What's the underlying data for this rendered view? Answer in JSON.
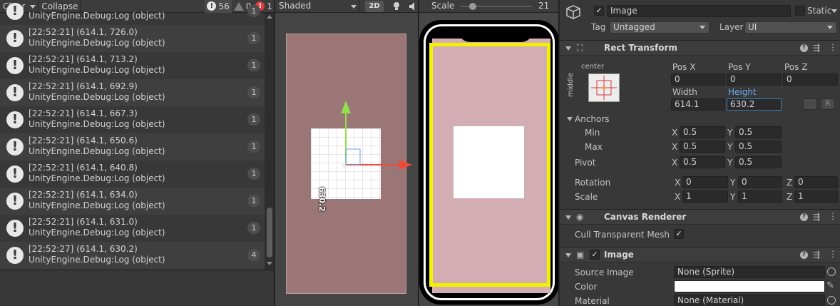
{
  "console": {
    "toolbar": {
      "clear_label": "Clear",
      "collapse_label": "Collapse",
      "info_count": "56",
      "warn_count": "0",
      "error_count": "1"
    },
    "logs": [
      {
        "line1": "",
        "line2": "UnityEngine.Debug:Log (object)",
        "count": "1"
      },
      {
        "line1": "[22:52:21] (614.1, 726.0)",
        "line2": "UnityEngine.Debug:Log (object)",
        "count": "1"
      },
      {
        "line1": "[22:52:21] (614.1, 713.2)",
        "line2": "UnityEngine.Debug:Log (object)",
        "count": "1"
      },
      {
        "line1": "[22:52:21] (614.1, 692.9)",
        "line2": "UnityEngine.Debug:Log (object)",
        "count": "1"
      },
      {
        "line1": "[22:52:21] (614.1, 667.3)",
        "line2": "UnityEngine.Debug:Log (object)",
        "count": "1"
      },
      {
        "line1": "[22:52:21] (614.1, 650.6)",
        "line2": "UnityEngine.Debug:Log (object)",
        "count": "1"
      },
      {
        "line1": "[22:52:21] (614.1, 640.8)",
        "line2": "UnityEngine.Debug:Log (object)",
        "count": "1"
      },
      {
        "line1": "[22:52:21] (614.1, 634.0)",
        "line2": "UnityEngine.Debug:Log (object)",
        "count": "1"
      },
      {
        "line1": "[22:52:21] (614.1, 631.0)",
        "line2": "UnityEngine.Debug:Log (object)",
        "count": "1"
      },
      {
        "line1": "[22:52:27] (614.1, 630.2)",
        "line2": "UnityEngine.Debug:Log (object)",
        "count": "4"
      }
    ]
  },
  "scene": {
    "shading_mode": "Shaded",
    "mode_2d": "2D",
    "gizmo_label": "630.2"
  },
  "game": {
    "scale_label": "Scale",
    "scale_value": "21"
  },
  "inspector": {
    "object_name": "Image",
    "static_label": "Static",
    "tag_label": "Tag",
    "tag_value": "Untagged",
    "layer_label": "Layer",
    "layer_value": "UI",
    "rect_transform": {
      "title": "Rect Transform",
      "anchor_h": "center",
      "anchor_v": "middle",
      "pos_x_label": "Pos X",
      "pos_x": "0",
      "pos_y_label": "Pos Y",
      "pos_y": "0",
      "pos_z_label": "Pos Z",
      "pos_z": "0",
      "width_label": "Width",
      "width": "614.1",
      "height_label": "Height",
      "height": "630.2",
      "blueprint_btn": "",
      "raw_btn": "R",
      "anchors_label": "Anchors",
      "min_label": "Min",
      "min_x": "0.5",
      "min_y": "0.5",
      "max_label": "Max",
      "max_x": "0.5",
      "max_y": "0.5",
      "pivot_label": "Pivot",
      "pivot_x": "0.5",
      "pivot_y": "0.5",
      "rotation_label": "Rotation",
      "rot_x": "0",
      "rot_y": "0",
      "rot_z": "0",
      "scale_label": "Scale",
      "scale_x": "1",
      "scale_y": "1",
      "scale_z": "1",
      "x": "X",
      "y": "Y",
      "z": "Z"
    },
    "canvas_renderer": {
      "title": "Canvas Renderer",
      "cull_label": "Cull Transparent Mesh"
    },
    "image": {
      "title": "Image",
      "source_label": "Source Image",
      "source_value": "None (Sprite)",
      "color_label": "Color",
      "color_value": "#ffffff",
      "material_label": "Material",
      "material_value": "None (Material)"
    }
  },
  "colors": {
    "game_bg": "#d2aeb4",
    "scene_canvas": "#9a7677",
    "safe_area": "#f2f200",
    "gizmo_y": "#8fe04b",
    "gizmo_x": "#ec4a3a"
  }
}
